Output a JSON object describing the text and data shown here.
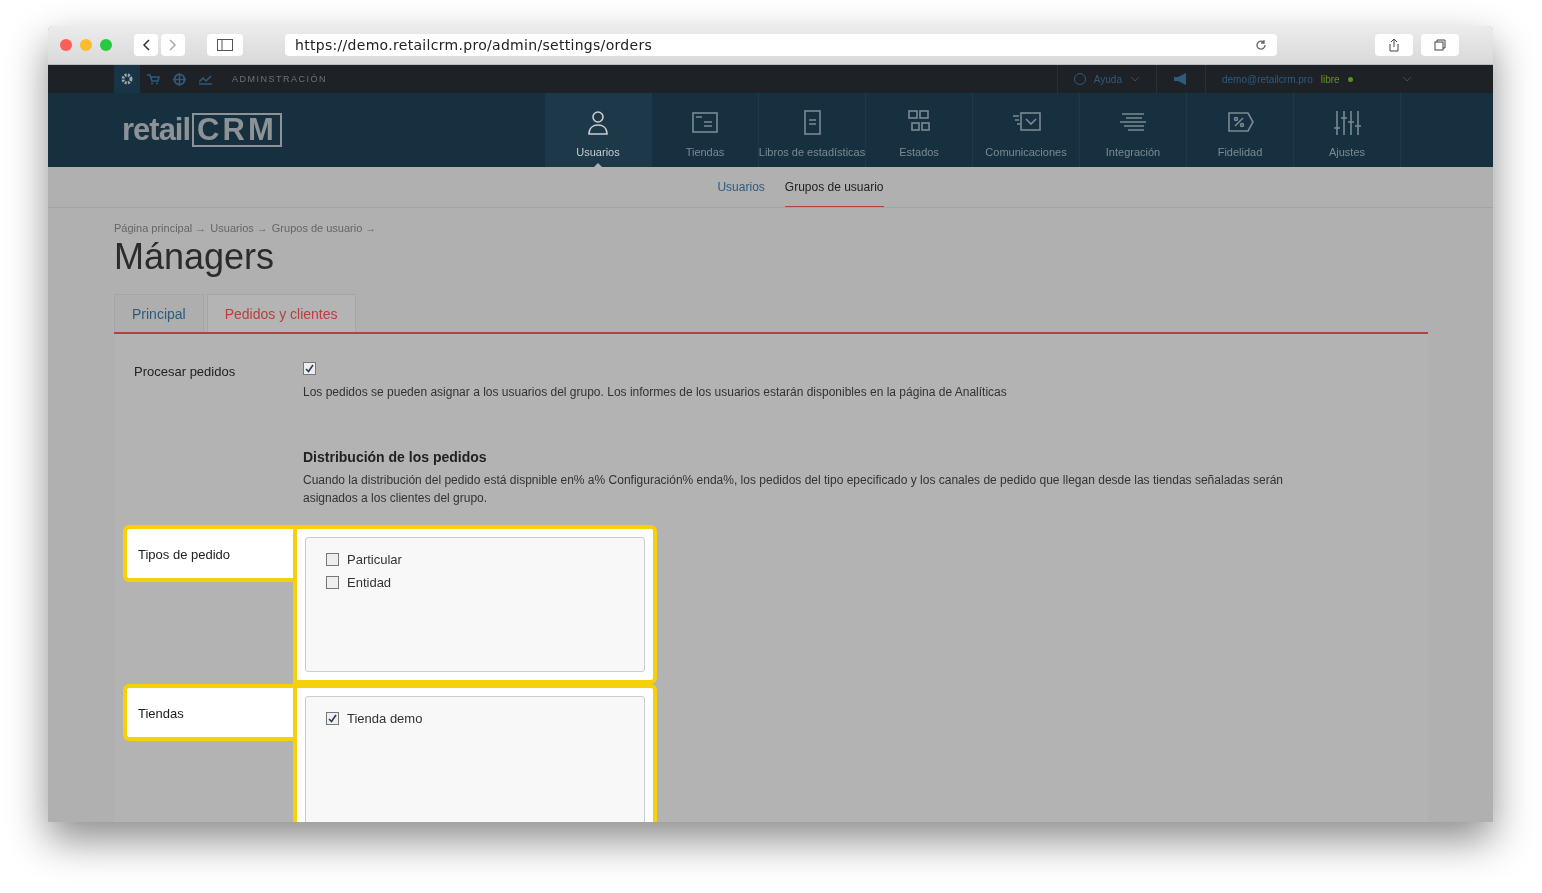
{
  "browser": {
    "url": "https://demo.retailcrm.pro/admin/settings/orders"
  },
  "topbar": {
    "section": "ADMINSTRACIÓN",
    "help": "Ayuda",
    "email": "demo@retailcrm.pro",
    "plan": "libre"
  },
  "logo": {
    "word": "retail",
    "mark": "CRM"
  },
  "nav": [
    {
      "label": "Usuarios",
      "selected": true
    },
    {
      "label": "Tiendas",
      "selected": false
    },
    {
      "label": "Libros de estadísticas",
      "selected": false
    },
    {
      "label": "Estados",
      "selected": false
    },
    {
      "label": "Comunicaciones",
      "selected": false
    },
    {
      "label": "Integración",
      "selected": false
    },
    {
      "label": "Fidelidad",
      "selected": false
    },
    {
      "label": "Ajustes",
      "selected": false
    }
  ],
  "subnav": [
    {
      "label": "Usuarios",
      "selected": false
    },
    {
      "label": "Grupos de usuario",
      "selected": true
    }
  ],
  "breadcrumb": [
    "Página principal →",
    "Usuarios →",
    "Grupos de usuario →"
  ],
  "title": "Mánagers",
  "tabs": [
    {
      "label": "Principal",
      "selected": false
    },
    {
      "label": "Pedidos y clientes",
      "selected": true
    }
  ],
  "process": {
    "label": "Procesar pedidos",
    "checked": true,
    "hint": "Los pedidos se pueden asignar a los usuarios del grupo. Los informes de los usuarios estarán disponibles en la página de Analíticas"
  },
  "distribution": {
    "heading": "Distribución de los pedidos",
    "text": "Cuando la distribución del pedido está dispnible en% a% Configuración% enda%, los pedidos del tipo epecificado y los canales de pedido que llegan desde las tiendas señaladas serán asignados a los clientes del grupo."
  },
  "fields": [
    {
      "label": "Tipos de pedido",
      "highlighted": true,
      "options": [
        {
          "label": "Particular",
          "checked": false
        },
        {
          "label": "Entidad",
          "checked": false
        }
      ]
    },
    {
      "label": "Tiendas",
      "highlighted": true,
      "options": [
        {
          "label": "Tienda demo",
          "checked": true
        }
      ]
    }
  ]
}
